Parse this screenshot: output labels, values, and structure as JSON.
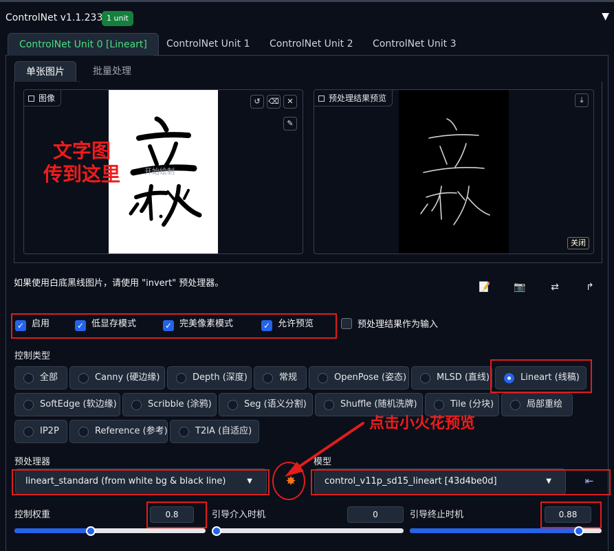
{
  "header": {
    "title": "ControlNet v1.1.233",
    "badge": "1 unit",
    "collapse_icon": "triangle-down-icon"
  },
  "unit_tabs": [
    "ControlNet Unit 0 [Lineart]",
    "ControlNet Unit 1",
    "ControlNet Unit 2",
    "ControlNet Unit 3"
  ],
  "sub_tabs": [
    "单张图片",
    "批量处理"
  ],
  "image_panel": {
    "label": "图像",
    "watermark": "开始绘制",
    "buttons": [
      "undo-icon",
      "eraser-icon",
      "close-icon",
      "brush-icon"
    ]
  },
  "annotation_upload": {
    "line1": "文字图",
    "line2": "传到这里"
  },
  "preview_panel": {
    "label": "预处理结果预览",
    "close_label": "关闭",
    "download_icon": "download-icon"
  },
  "hint_text": "如果使用白底黑线图片，请使用 \"invert\" 预处理器。",
  "tool_icons": [
    "new-canvas-icon",
    "camera-icon",
    "swap-icon",
    "send-dimensions-icon"
  ],
  "checkboxes": [
    {
      "label": "启用",
      "checked": true
    },
    {
      "label": "低显存模式",
      "checked": true
    },
    {
      "label": "完美像素模式",
      "checked": true
    },
    {
      "label": "允许预览",
      "checked": true
    },
    {
      "label": "预处理结果作为输入",
      "checked": false
    }
  ],
  "control_type": {
    "label": "控制类型",
    "selected": "Lineart (线稿)",
    "options": [
      "全部",
      "Canny (硬边缘)",
      "Depth (深度)",
      "常规",
      "OpenPose (姿态)",
      "MLSD (直线)",
      "Lineart (线稿)",
      "SoftEdge (软边缘)",
      "Scribble (涂鸦)",
      "Seg (语义分割)",
      "Shuffle (随机洗牌)",
      "Tile (分块)",
      "局部重绘",
      "IP2P",
      "Reference (参考)",
      "T2IA (自适应)"
    ]
  },
  "annotation_spark": {
    "text": "点击小火花预览"
  },
  "preprocessor": {
    "label": "预处理器",
    "value": "lineart_standard (from white bg & black line)"
  },
  "run_preprocessor_icon": "spark-icon",
  "model": {
    "label": "模型",
    "value": "control_v11p_sd15_lineart [43d4be0d]",
    "refresh_icon": "refresh-models-icon"
  },
  "sliders": [
    {
      "label": "控制权重",
      "value": "0.8",
      "fraction": 0.4
    },
    {
      "label": "引导介入时机",
      "value": "0",
      "fraction": 0.0
    },
    {
      "label": "引导终止时机",
      "value": "0.88",
      "fraction": 0.88
    }
  ],
  "colors": {
    "accent": "#2563eb",
    "active_tab": "#4ade80",
    "annotation": "#e11d1d",
    "badge": "#15803d"
  }
}
